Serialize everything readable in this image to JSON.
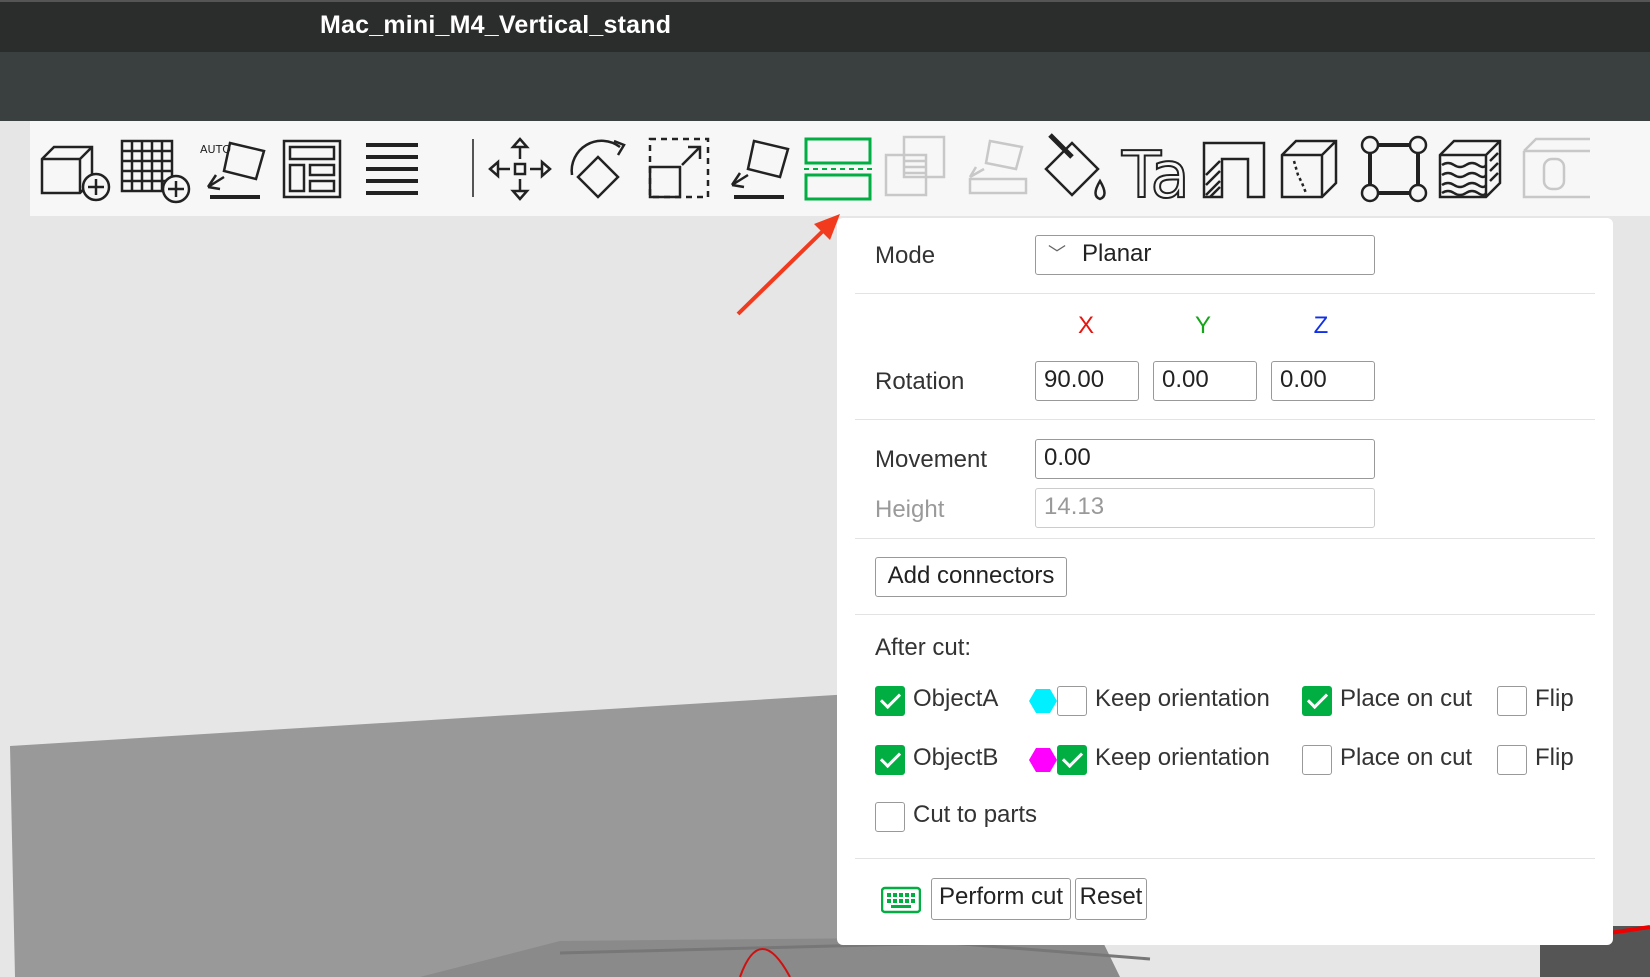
{
  "window": {
    "title": "Mac_mini_M4_Vertical_stand"
  },
  "toolbar": {
    "items": [
      "add-object-icon",
      "add-plate-icon",
      "auto-orient-icon",
      "arrange-icon",
      "split-layers-icon",
      "move-icon",
      "rotate-icon",
      "scale-icon",
      "lay-on-face-icon",
      "cut-icon",
      "boolean-icon",
      "assembly-icon",
      "paint-bucket-icon",
      "text-icon",
      "seam-icon",
      "support-paint-icon",
      "measure-icon",
      "fuzzy-skin-icon",
      "more-icon"
    ],
    "auto_label": "AUTO",
    "text_tool_glyph": "Ta",
    "active_color": "#00ae42"
  },
  "cut_panel": {
    "mode_label": "Mode",
    "mode_value": "Planar",
    "axes": {
      "x": "X",
      "y": "Y",
      "z": "Z"
    },
    "axis_colors": {
      "x": "#e8150f",
      "y": "#15a51a",
      "z": "#1130e8"
    },
    "rotation_label": "Rotation",
    "rotation": {
      "x": "90.00",
      "y": "0.00",
      "z": "0.00"
    },
    "movement_label": "Movement",
    "movement_value": "0.00",
    "height_label": "Height",
    "height_value": "14.13",
    "add_connectors_label": "Add connectors",
    "after_cut_label": "After cut:",
    "object_a": {
      "label": "ObjectA",
      "checked": true,
      "color": "#00f0ff",
      "keep_orientation": {
        "label": "Keep orientation",
        "checked": false
      },
      "place_on_cut": {
        "label": "Place on cut",
        "checked": true
      },
      "flip": {
        "label": "Flip",
        "checked": false
      }
    },
    "object_b": {
      "label": "ObjectB",
      "checked": true,
      "color": "#ff00ff",
      "keep_orientation": {
        "label": "Keep orientation",
        "checked": true
      },
      "place_on_cut": {
        "label": "Place on cut",
        "checked": false
      },
      "flip": {
        "label": "Flip",
        "checked": false
      }
    },
    "cut_to_parts": {
      "label": "Cut to parts",
      "checked": false
    },
    "perform_cut_label": "Perform cut",
    "reset_label": "Reset"
  },
  "annotation": {
    "arrow_color": "#f23a1e"
  }
}
